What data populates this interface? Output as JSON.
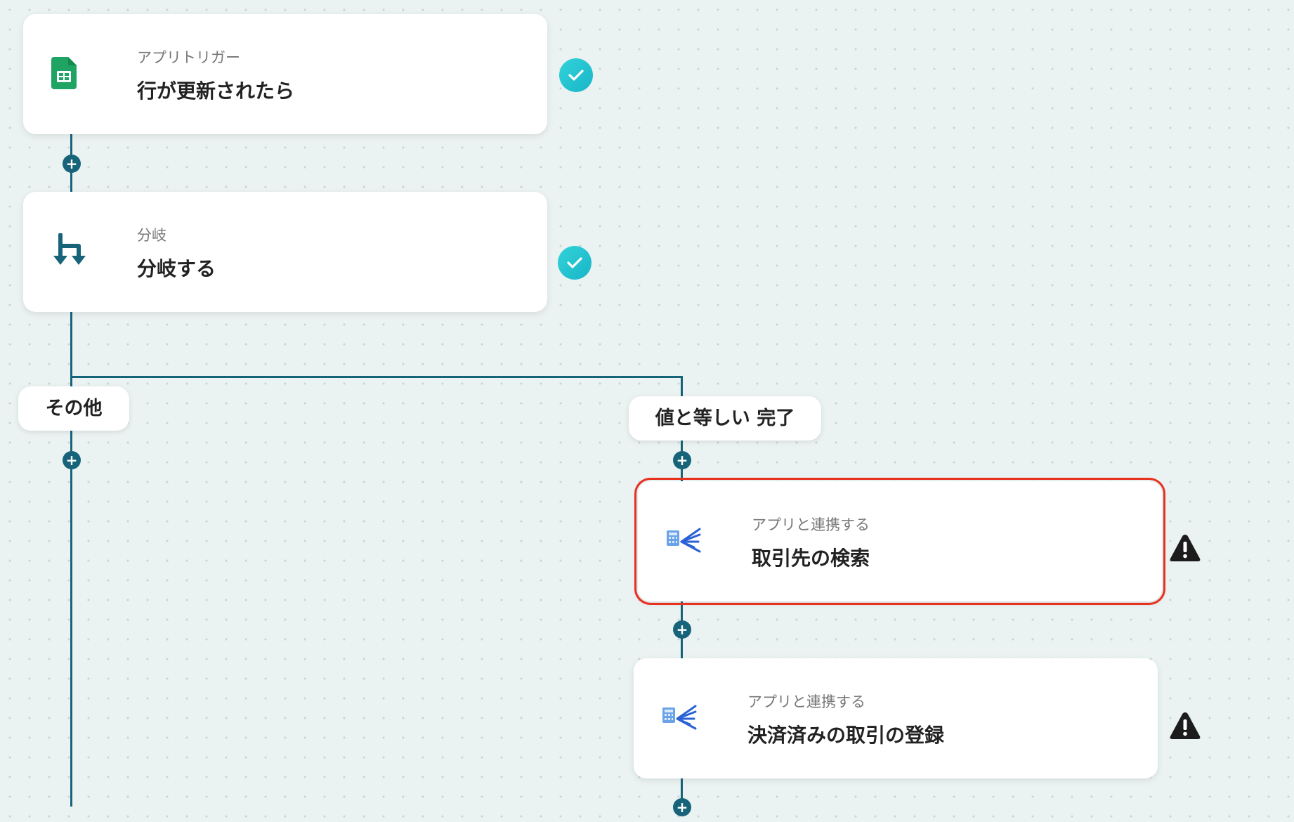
{
  "flow": {
    "steps": [
      {
        "sub": "アプリトリガー",
        "title": "行が更新されたら",
        "app_icon": "google-sheets-icon",
        "status": "complete"
      },
      {
        "sub": "分岐",
        "title": "分岐する",
        "app_icon": "branch-icon",
        "status": "complete"
      },
      {
        "sub": "アプリと連携する",
        "title": "取引先の検索",
        "app_icon": "accounting-app-icon",
        "status": "warning",
        "selected": true
      },
      {
        "sub": "アプリと連携する",
        "title": "決済済みの取引の登録",
        "app_icon": "accounting-app-icon",
        "status": "warning"
      }
    ],
    "branches": [
      {
        "label": "その他"
      },
      {
        "label": "値と等しい 完了"
      }
    ],
    "add_symbol": "+"
  },
  "colors": {
    "connector": "#17647a",
    "check": "#1fc3d1",
    "warning": "#1c1c1c",
    "selection": "#e8311f",
    "sheets_green": "#1fa463"
  }
}
